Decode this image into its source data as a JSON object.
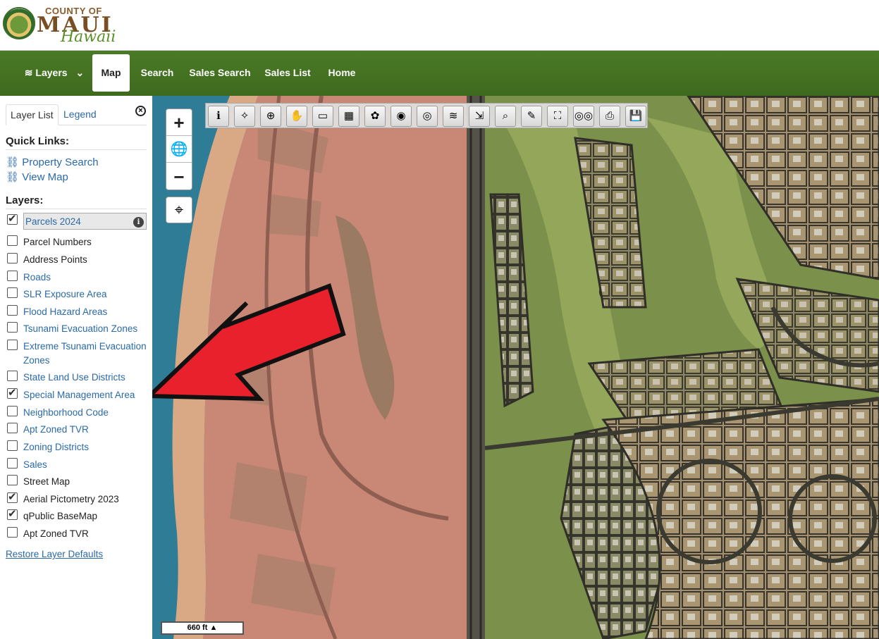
{
  "header": {
    "logo_county": "COUNTY OF",
    "logo_maui": "MAUI",
    "logo_hawaii": "Hawaii"
  },
  "nav": {
    "layers": "Layers",
    "map": "Map",
    "search": "Search",
    "sales_search": "Sales Search",
    "sales_list": "Sales List",
    "home": "Home"
  },
  "sidebar": {
    "tab_layer_list": "Layer List",
    "tab_legend": "Legend",
    "quick_links_title": "Quick Links:",
    "quick_links": [
      "Property Search",
      "View Map"
    ],
    "layers_title": "Layers:",
    "layers": [
      {
        "label": "Parcels 2024",
        "checked": true,
        "style": "link"
      },
      {
        "label": "Parcel Numbers",
        "checked": false,
        "style": "plain"
      },
      {
        "label": "Address Points",
        "checked": false,
        "style": "plain"
      },
      {
        "label": "Roads",
        "checked": false,
        "style": "link"
      },
      {
        "label": "SLR Exposure Area",
        "checked": false,
        "style": "link"
      },
      {
        "label": "Flood Hazard Areas",
        "checked": false,
        "style": "link"
      },
      {
        "label": "Tsunami Evacuation Zones",
        "checked": false,
        "style": "link"
      },
      {
        "label": "Extreme Tsunami Evacuation Zones",
        "checked": false,
        "style": "link"
      },
      {
        "label": "State Land Use Districts",
        "checked": false,
        "style": "link"
      },
      {
        "label": "Special Management Area",
        "checked": true,
        "style": "link"
      },
      {
        "label": "Neighborhood Code",
        "checked": false,
        "style": "link"
      },
      {
        "label": "Apt Zoned TVR",
        "checked": false,
        "style": "link"
      },
      {
        "label": "Zoning Districts",
        "checked": false,
        "style": "link"
      },
      {
        "label": "Sales",
        "checked": false,
        "style": "link"
      },
      {
        "label": "Street Map",
        "checked": false,
        "style": "plain"
      },
      {
        "label": "Aerial Pictometry 2023",
        "checked": true,
        "style": "plain"
      },
      {
        "label": "qPublic BaseMap",
        "checked": true,
        "style": "plain"
      },
      {
        "label": "Apt Zoned TVR",
        "checked": false,
        "style": "plain"
      }
    ],
    "restore": "Restore Layer Defaults"
  },
  "map": {
    "zoom_in": "+",
    "zoom_out": "−",
    "scale_label": "660 ft",
    "tools": [
      "info-icon",
      "select-icon",
      "zoom-in-tool-icon",
      "pan-hand-icon",
      "eraser-icon",
      "select-parcels-icon",
      "marker-icon",
      "layers-globe-icon",
      "camera-icon",
      "measure-icon",
      "buffer-icon",
      "find-icon",
      "draw-pencil-icon",
      "fullscreen-icon",
      "binoculars-icon",
      "print-icon",
      "save-icon"
    ],
    "colors": {
      "sma_overlay": "#e07a6a",
      "arrow": "#e8212c"
    }
  }
}
